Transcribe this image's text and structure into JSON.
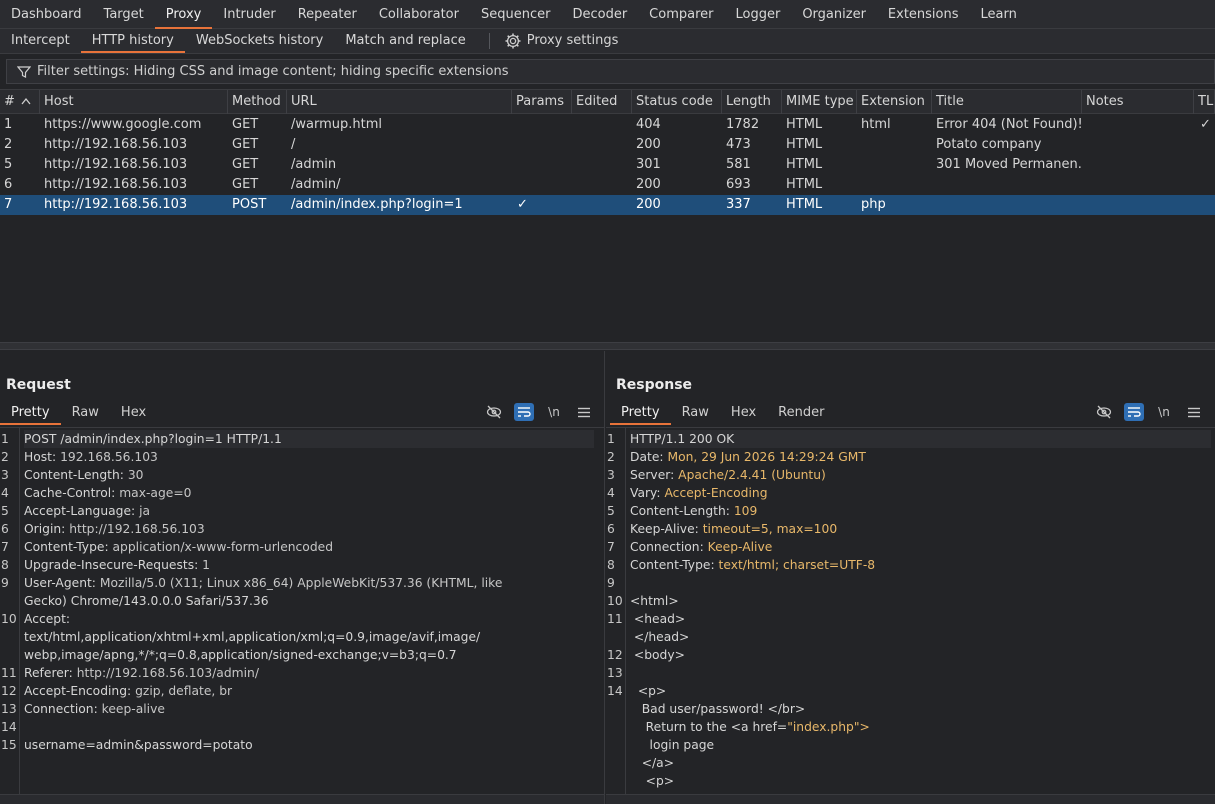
{
  "nav": {
    "tabs": [
      "Dashboard",
      "Target",
      "Proxy",
      "Intruder",
      "Repeater",
      "Collaborator",
      "Sequencer",
      "Decoder",
      "Comparer",
      "Logger",
      "Organizer",
      "Extensions",
      "Learn"
    ],
    "active": "Proxy"
  },
  "subnav": {
    "tabs": [
      "Intercept",
      "HTTP history",
      "WebSockets history",
      "Match and replace"
    ],
    "active": "HTTP history",
    "settings_label": "Proxy settings"
  },
  "filter": {
    "text": "Filter settings: Hiding CSS and image content; hiding specific extensions"
  },
  "table": {
    "headers": [
      "#",
      "Host",
      "Method",
      "URL",
      "Params",
      "Edited",
      "Status code",
      "Length",
      "MIME type",
      "Extension",
      "Title",
      "Notes",
      "TLS"
    ],
    "rows": [
      {
        "num": "1",
        "host": "https://www.google.com",
        "method": "GET",
        "url": "/warmup.html",
        "params": "",
        "edited": "",
        "status": "404",
        "length": "1782",
        "mime": "HTML",
        "ext": "html",
        "title": "Error 404 (Not Found)!...",
        "notes": "",
        "tls": "✓",
        "selected": false
      },
      {
        "num": "2",
        "host": "http://192.168.56.103",
        "method": "GET",
        "url": "/",
        "params": "",
        "edited": "",
        "status": "200",
        "length": "473",
        "mime": "HTML",
        "ext": "",
        "title": "Potato company",
        "notes": "",
        "tls": "",
        "selected": false
      },
      {
        "num": "5",
        "host": "http://192.168.56.103",
        "method": "GET",
        "url": "/admin",
        "params": "",
        "edited": "",
        "status": "301",
        "length": "581",
        "mime": "HTML",
        "ext": "",
        "title": "301 Moved Permanen...",
        "notes": "",
        "tls": "",
        "selected": false
      },
      {
        "num": "6",
        "host": "http://192.168.56.103",
        "method": "GET",
        "url": "/admin/",
        "params": "",
        "edited": "",
        "status": "200",
        "length": "693",
        "mime": "HTML",
        "ext": "",
        "title": "",
        "notes": "",
        "tls": "",
        "selected": false
      },
      {
        "num": "7",
        "host": "http://192.168.56.103",
        "method": "POST",
        "url": "/admin/index.php?login=1",
        "params": "✓",
        "edited": "",
        "status": "200",
        "length": "337",
        "mime": "HTML",
        "ext": "php",
        "title": "",
        "notes": "",
        "tls": "",
        "selected": true
      }
    ]
  },
  "request": {
    "title": "Request",
    "tabs": [
      "Pretty",
      "Raw",
      "Hex"
    ],
    "active": "Pretty",
    "lines": [
      {
        "n": "1",
        "k": "POST /admin/index.php?login=1 HTTP/1.1",
        "v": ""
      },
      {
        "n": "2",
        "k": "Host:",
        "v": " 192.168.56.103"
      },
      {
        "n": "3",
        "k": "Content-Length:",
        "v": " 30"
      },
      {
        "n": "4",
        "k": "Cache-Control:",
        "v": " max-age=0"
      },
      {
        "n": "5",
        "k": "Accept-Language:",
        "v": " ja"
      },
      {
        "n": "6",
        "k": "Origin:",
        "v": " http://192.168.56.103"
      },
      {
        "n": "7",
        "k": "Content-Type:",
        "v": " application/x-www-form-urlencoded"
      },
      {
        "n": "8",
        "k": "Upgrade-Insecure-Requests:",
        "v": " 1"
      },
      {
        "n": "9",
        "k": "User-Agent:",
        "v": " Mozilla/5.0 (X11; Linux x86_64) AppleWebKit/537.36 (KHTML, like"
      },
      {
        "n": "",
        "k": "Gecko) Chrome/143.0.0.0 Safari/537.36",
        "v": ""
      },
      {
        "n": "10",
        "k": "Accept:",
        "v": ""
      },
      {
        "n": "",
        "k": "text/html,application/xhtml+xml,application/xml;q=0.9,image/avif,image/",
        "v": ""
      },
      {
        "n": "",
        "k": "webp,image/apng,*/*;q=0.8,application/signed-exchange;v=b3;q=0.7",
        "v": ""
      },
      {
        "n": "11",
        "k": "Referer:",
        "v": " http://192.168.56.103/admin/"
      },
      {
        "n": "12",
        "k": "Accept-Encoding:",
        "v": " gzip, deflate, br"
      },
      {
        "n": "13",
        "k": "Connection:",
        "v": " keep-alive"
      },
      {
        "n": "14",
        "k": "",
        "v": ""
      },
      {
        "n": "15",
        "k": "username=admin&password=potato",
        "v": ""
      }
    ]
  },
  "response": {
    "title": "Response",
    "tabs": [
      "Pretty",
      "Raw",
      "Hex",
      "Render"
    ],
    "active": "Pretty",
    "lines": [
      {
        "n": "1",
        "k": "HTTP/1.1 200 OK",
        "v": ""
      },
      {
        "n": "2",
        "k": "Date:",
        "v": " Mon, 29 Jun 2026 14:29:24 GMT"
      },
      {
        "n": "3",
        "k": "Server:",
        "v": " Apache/2.4.41 (Ubuntu)"
      },
      {
        "n": "4",
        "k": "Vary:",
        "v": " Accept-Encoding"
      },
      {
        "n": "5",
        "k": "Content-Length:",
        "v": " 109"
      },
      {
        "n": "6",
        "k": "Keep-Alive:",
        "v": " timeout=5, max=100"
      },
      {
        "n": "7",
        "k": "Connection:",
        "v": " Keep-Alive"
      },
      {
        "n": "8",
        "k": "Content-Type:",
        "v": " text/html; charset=UTF-8"
      },
      {
        "n": "9",
        "k": "",
        "v": ""
      },
      {
        "n": "10",
        "k": "<html>",
        "v": ""
      },
      {
        "n": "11",
        "k": " <head>",
        "v": ""
      },
      {
        "n": "",
        "k": " </head>",
        "v": ""
      },
      {
        "n": "12",
        "k": " <body>",
        "v": ""
      },
      {
        "n": "13",
        "k": "",
        "v": ""
      },
      {
        "n": "14",
        "k": "  <p>",
        "v": ""
      },
      {
        "n": "",
        "k": "   Bad user/password! </br>",
        "v": ""
      },
      {
        "n": "",
        "k": "    Return to the <a href=",
        "v": "\"index.php\">"
      },
      {
        "n": "",
        "k": "     login page",
        "v": ""
      },
      {
        "n": "",
        "k": "   </a>",
        "v": ""
      },
      {
        "n": "",
        "k": "    <p>",
        "v": ""
      }
    ]
  },
  "colors": {
    "accent": "#e8733a",
    "selection": "#1f4e7a",
    "toggle_on": "#2f6fb5"
  },
  "icons": [
    "filter-icon",
    "gear-icon",
    "eye-off-icon",
    "wrap-icon",
    "newline-icon",
    "menu-icon",
    "sort-asc-icon",
    "check-icon"
  ]
}
